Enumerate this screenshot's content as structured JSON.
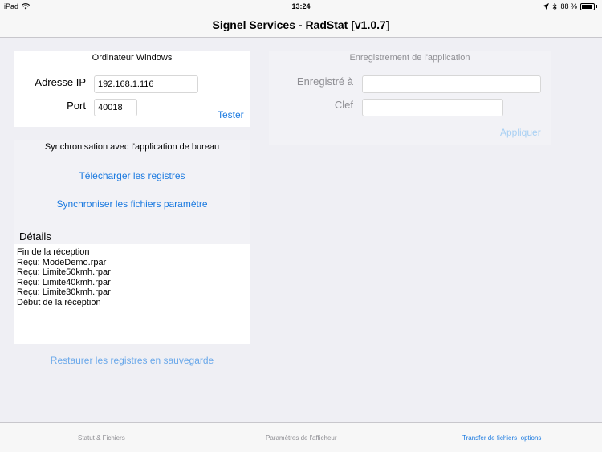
{
  "status_bar": {
    "device": "iPad",
    "time": "13:24",
    "battery": "88 %",
    "wifi_icon": "wifi-icon",
    "location_icon": "location-arrow-icon",
    "bluetooth_icon": "bluetooth-icon"
  },
  "nav": {
    "title": "Signel Services - RadStat [v1.0.7]"
  },
  "windows_panel": {
    "title": "Ordinateur Windows",
    "ip_label": "Adresse IP",
    "ip_value": "192.168.1.116",
    "port_label": "Port",
    "port_value": "40018",
    "test_button": "Tester"
  },
  "registration_panel": {
    "title": "Enregistrement de l'application",
    "registered_label": "Enregistré à",
    "registered_value": "",
    "key_label": "Clef",
    "key_value": "",
    "apply_button": "Appliquer"
  },
  "sync_panel": {
    "title": "Synchronisation avec l'application de bureau",
    "download_button": "Télécharger les registres",
    "sync_button": "Synchroniser les fichiers paramètre"
  },
  "details": {
    "title": "Détails",
    "lines": [
      "Fin de la réception",
      "Reçu: ModeDemo.rpar",
      "Reçu: Limite50kmh.rpar",
      "Reçu: Limite40kmh.rpar",
      "Reçu: Limite30kmh.rpar",
      "Début de la réception"
    ]
  },
  "restore_button": "Restaurer les registres en sauvegarde",
  "tabs": [
    {
      "label": "Statut & Fichiers"
    },
    {
      "label": "Paramètres de l'afficheur"
    },
    {
      "label": "Transfer de fichiers  options"
    }
  ],
  "colors": {
    "accent": "#1b7ae0",
    "background": "#efeff4"
  }
}
